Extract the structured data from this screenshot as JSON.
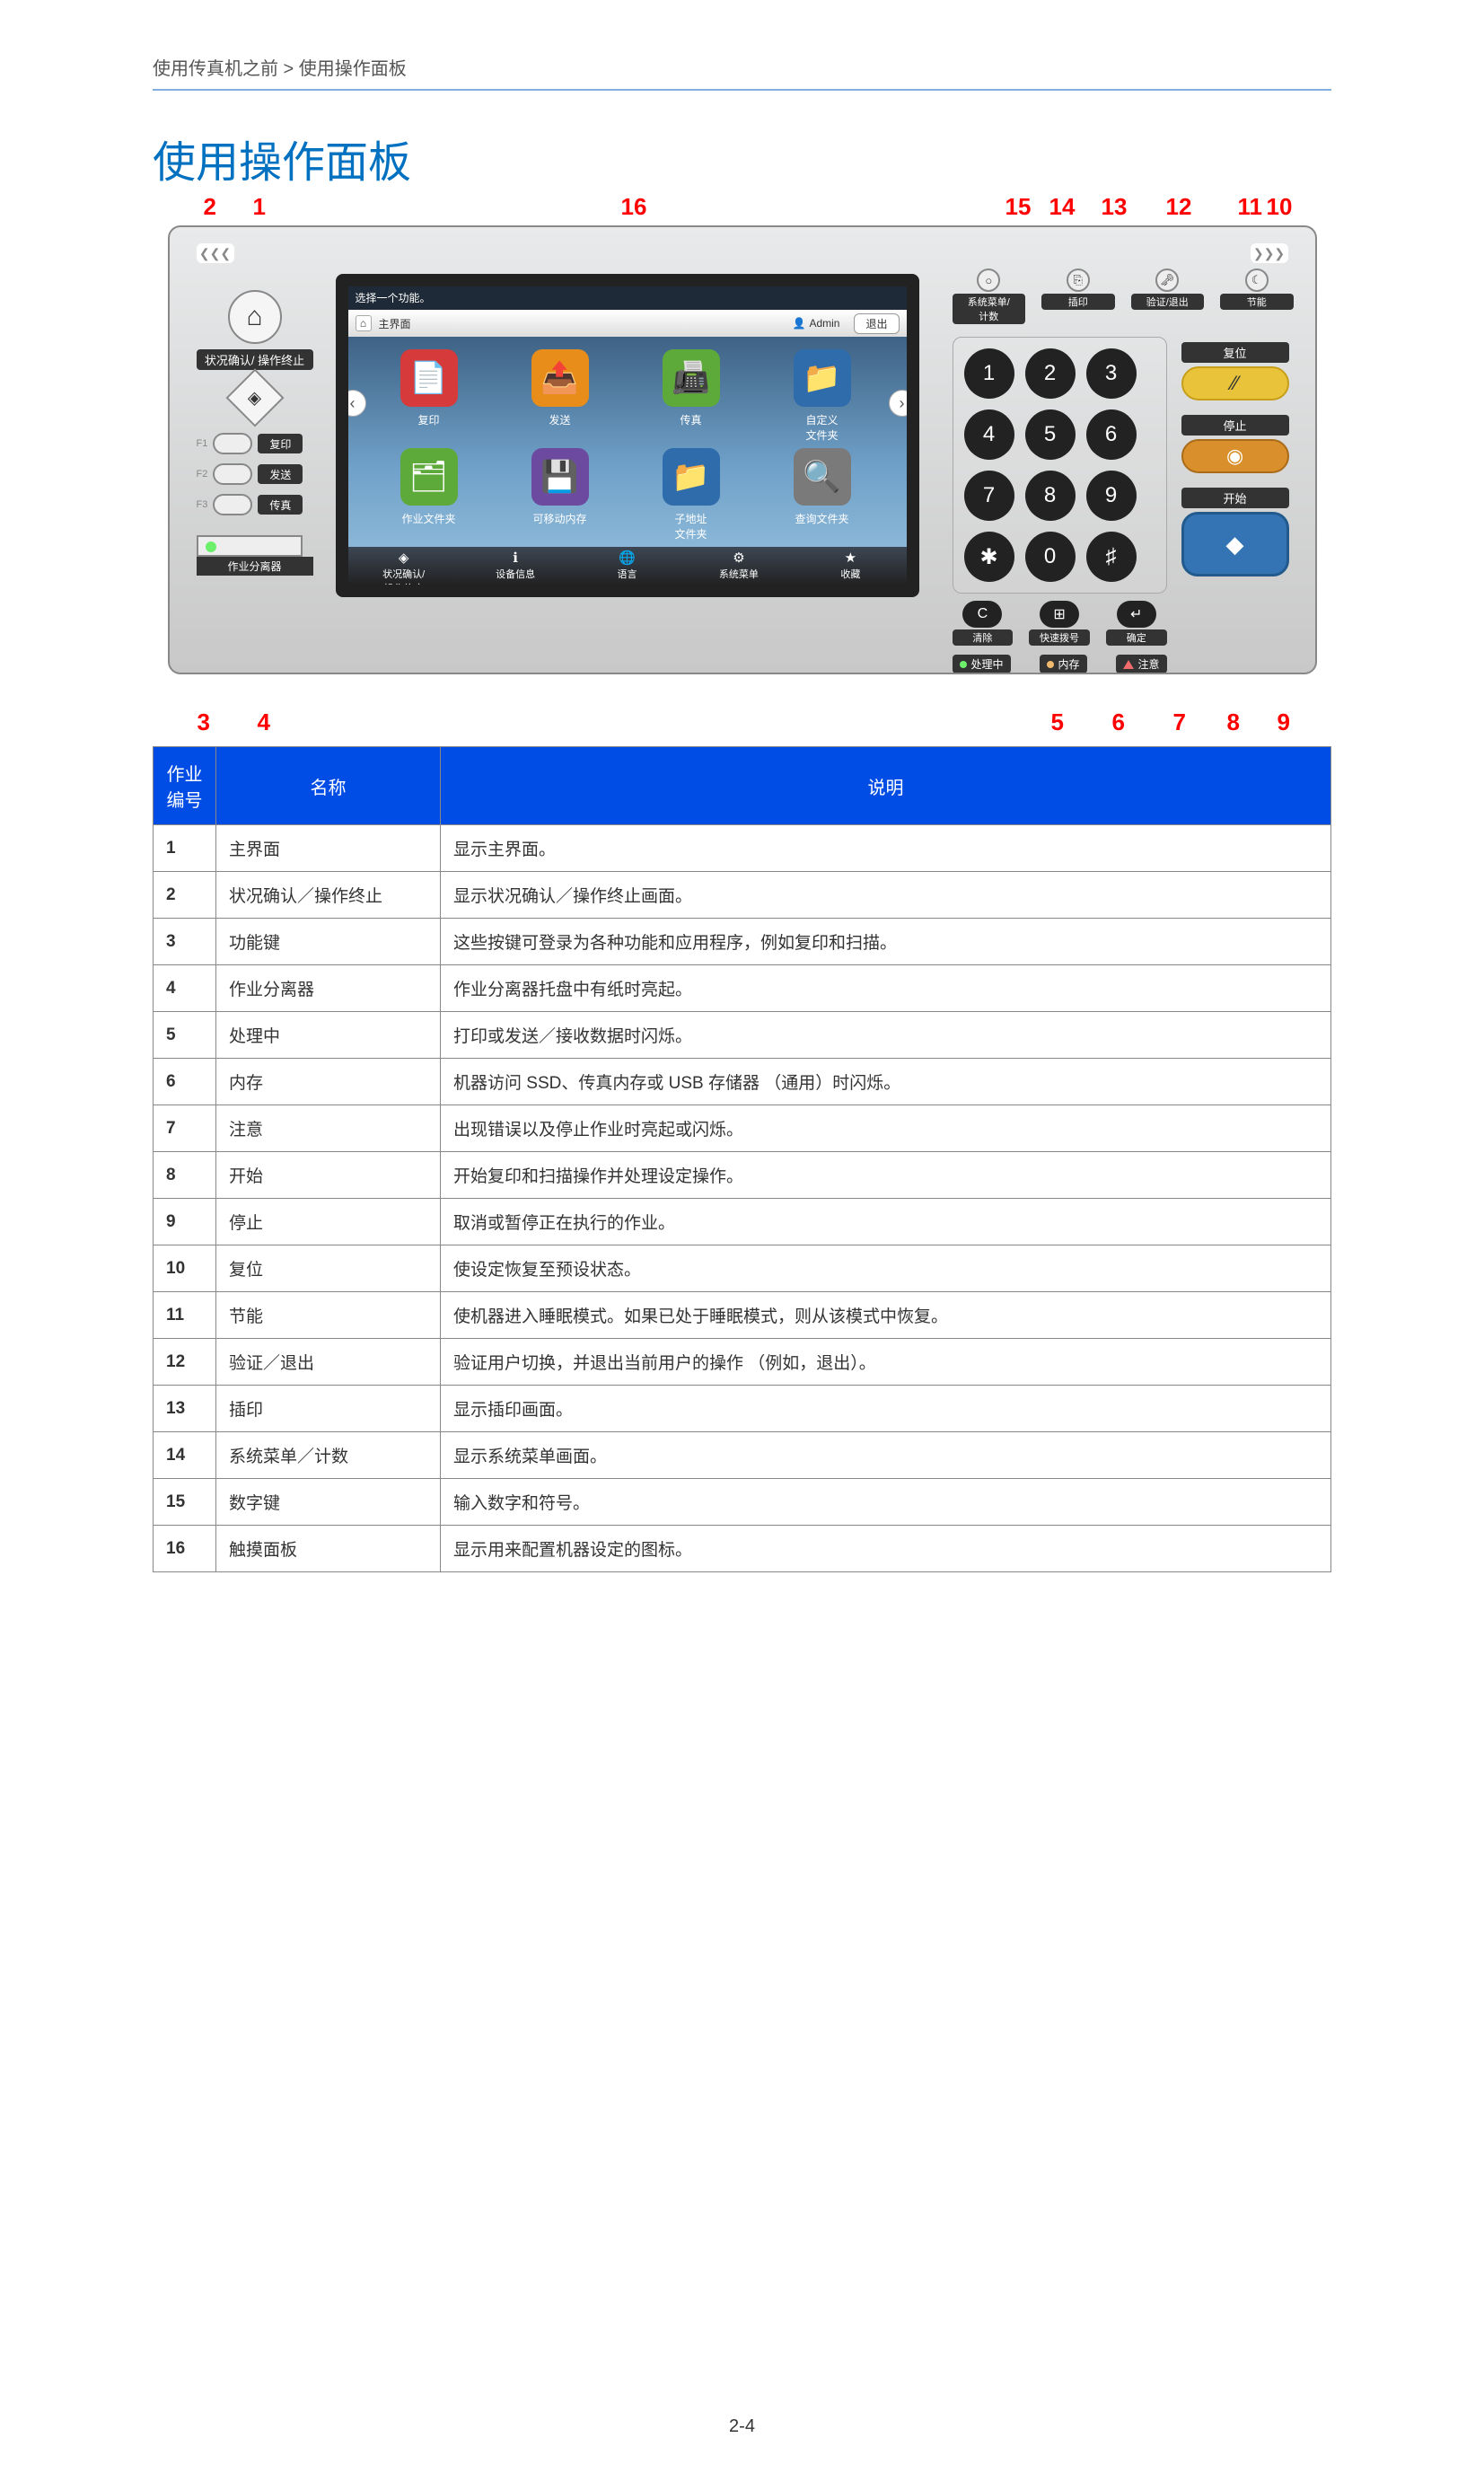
{
  "breadcrumb": "使用传真机之前 > 使用操作面板",
  "title": "使用操作面板",
  "page_num": "2-4",
  "callouts_top": {
    "2": "2",
    "1": "1",
    "16": "16",
    "15": "15",
    "14": "14",
    "13": "13",
    "12": "12",
    "11": "11",
    "10": "10"
  },
  "callouts_bot": {
    "3": "3",
    "4": "4",
    "5": "5",
    "6": "6",
    "7": "7",
    "8": "8",
    "9": "9"
  },
  "panel": {
    "left_dots": "❮❮❮",
    "right_dots": "❯❯❯",
    "home_glyph": "⌂",
    "status_label": "状况确认/\n操作终止",
    "diamond_glyph": "◈",
    "fn": [
      {
        "tag": "F1",
        "name": "复印"
      },
      {
        "tag": "F2",
        "name": "发送"
      },
      {
        "tag": "F3",
        "name": "传真"
      }
    ],
    "separator_label": "作业分离器",
    "screen": {
      "prompt": "选择一个功能。",
      "home_label": "主界面",
      "admin_icon": "👤",
      "admin_name": "Admin",
      "logout": "退出",
      "apps_r1": [
        {
          "cls": "red",
          "glyph": "📄",
          "name": "复印"
        },
        {
          "cls": "org",
          "glyph": "📤",
          "name": "发送"
        },
        {
          "cls": "grn",
          "glyph": "📠",
          "name": "传真"
        },
        {
          "cls": "blu",
          "glyph": "📁",
          "name": "自定义\n文件夹"
        }
      ],
      "apps_r2": [
        {
          "cls": "grn",
          "glyph": "🗂",
          "name": "作业文件夹"
        },
        {
          "cls": "pur",
          "glyph": "💾",
          "name": "可移动内存"
        },
        {
          "cls": "blu",
          "glyph": "📁",
          "name": "子地址\n文件夹"
        },
        {
          "cls": "gry",
          "glyph": "🔍",
          "name": "查询文件夹"
        }
      ],
      "nav_left": "‹",
      "nav_right": "›",
      "bottom_items": [
        {
          "glyph": "◈",
          "name": "状况确认/\n操作终止"
        },
        {
          "glyph": "ℹ",
          "name": "设备信息"
        },
        {
          "glyph": "🌐",
          "name": "语言"
        },
        {
          "glyph": "⚙",
          "name": "系统菜单"
        },
        {
          "glyph": "★",
          "name": "收藏"
        }
      ]
    },
    "top_buttons": [
      {
        "glyph": "○",
        "label": "系统菜单/\n计数"
      },
      {
        "glyph": "⎘",
        "label": "插印"
      },
      {
        "glyph": "🗝",
        "label": "验证/退出"
      },
      {
        "glyph": "☾",
        "label": "节能"
      }
    ],
    "keypad": [
      "1",
      "2",
      "3",
      "4",
      "5",
      "6",
      "7",
      "8",
      "9",
      "✱",
      "0",
      "♯"
    ],
    "sub_keys": [
      {
        "glyph": "C",
        "label": "清除"
      },
      {
        "glyph": "⊞",
        "label": "快速拨号"
      },
      {
        "glyph": "↵",
        "label": "确定"
      }
    ],
    "side_buttons": {
      "reset": {
        "label": "复位",
        "glyph": "⁄⁄"
      },
      "stop": {
        "label": "停止",
        "glyph": "◉"
      },
      "start": {
        "label": "开始",
        "glyph": "◆"
      }
    },
    "indicators": [
      {
        "type": "dot2",
        "label": "处理中"
      },
      {
        "type": "dot3",
        "label": "内存"
      },
      {
        "type": "tri",
        "label": "注意"
      }
    ]
  },
  "table": {
    "headers": [
      "作业\n编号",
      "名称",
      "说明"
    ],
    "rows": [
      [
        "1",
        "主界面",
        "显示主界面。"
      ],
      [
        "2",
        "状况确认／操作终止",
        "显示状况确认／操作终止画面。"
      ],
      [
        "3",
        "功能键",
        "这些按键可登录为各种功能和应用程序，例如复印和扫描。"
      ],
      [
        "4",
        "作业分离器",
        "作业分离器托盘中有纸时亮起。"
      ],
      [
        "5",
        "处理中",
        "打印或发送／接收数据时闪烁。"
      ],
      [
        "6",
        "内存",
        "机器访问 SSD、传真内存或 USB 存储器 （通用）时闪烁。"
      ],
      [
        "7",
        "注意",
        "出现错误以及停止作业时亮起或闪烁。"
      ],
      [
        "8",
        "开始",
        "开始复印和扫描操作并处理设定操作。"
      ],
      [
        "9",
        "停止",
        "取消或暂停正在执行的作业。"
      ],
      [
        "10",
        "复位",
        "使设定恢复至预设状态。"
      ],
      [
        "11",
        "节能",
        "使机器进入睡眠模式。如果已处于睡眠模式，则从该模式中恢复。"
      ],
      [
        "12",
        "验证／退出",
        "验证用户切换，并退出当前用户的操作 （例如，退出）。"
      ],
      [
        "13",
        "插印",
        "显示插印画面。"
      ],
      [
        "14",
        "系统菜单／计数",
        "显示系统菜单画面。"
      ],
      [
        "15",
        "数字键",
        "输入数字和符号。"
      ],
      [
        "16",
        "触摸面板",
        "显示用来配置机器设定的图标。"
      ]
    ]
  }
}
